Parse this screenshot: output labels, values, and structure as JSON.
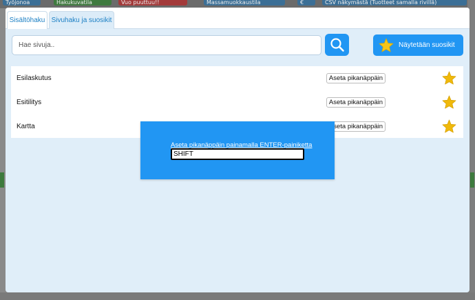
{
  "app": {
    "toolbar": [
      "Työjonoa",
      "Hakukuvatila",
      "Vuo puuttuu!!",
      "Massamuokkaustila",
      "€",
      "CSV näkymästä (Tuotteet samalla rivillä)"
    ]
  },
  "tabs": [
    {
      "label": "Sisältöhaku"
    },
    {
      "label": "Sivuhaku ja suosikit"
    }
  ],
  "search": {
    "placeholder": "Hae sivuja.."
  },
  "favorites_button": {
    "label": "Näytetään suosikit"
  },
  "pages": [
    {
      "name": "Esilaskutus",
      "action_label": "Aseta pikanäppäin"
    },
    {
      "name": "Esitilitys",
      "action_label": "Aseta pikanäppäin"
    },
    {
      "name": "Kartta",
      "action_label": "Aseta pikanäppäin"
    }
  ],
  "shortcut_dialog": {
    "title": "Aseta pikanäppäin painamalla ENTER-painiketta",
    "value": "SHIFT"
  },
  "colors": {
    "accent": "#2196f3",
    "star": "#f5c518",
    "modal_bg": "#e0eef9"
  }
}
